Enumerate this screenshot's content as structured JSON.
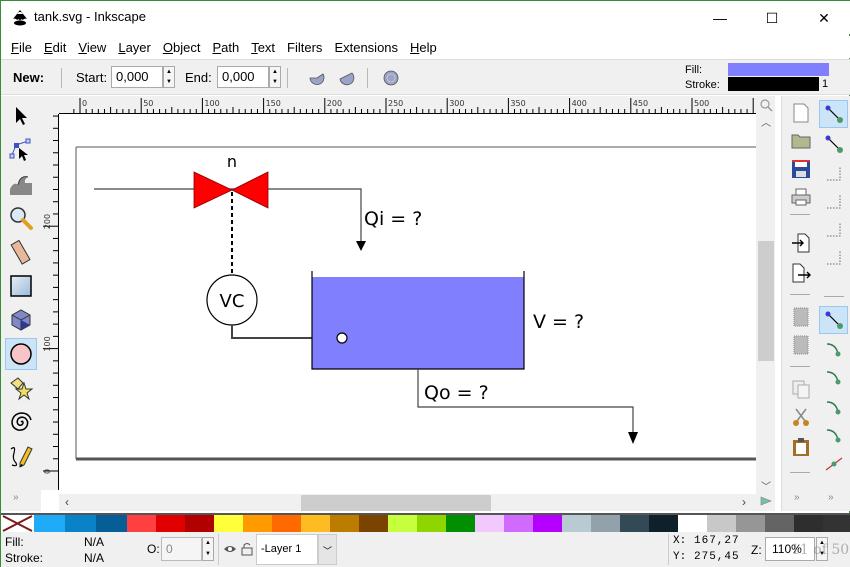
{
  "window": {
    "title": "tank.svg - Inkscape",
    "minimize_glyph": "—",
    "maximize_glyph": "☐",
    "close_glyph": "✕"
  },
  "menu": [
    {
      "label": "File",
      "accel": "F",
      "rest": "ile"
    },
    {
      "label": "Edit",
      "accel": "E",
      "rest": "dit"
    },
    {
      "label": "View",
      "accel": "V",
      "rest": "iew"
    },
    {
      "label": "Layer",
      "accel": "L",
      "rest": "ayer"
    },
    {
      "label": "Object",
      "accel": "O",
      "rest": "bject"
    },
    {
      "label": "Path",
      "accel": "P",
      "rest": "ath"
    },
    {
      "label": "Text",
      "accel": "T",
      "rest": "ext"
    },
    {
      "label": "Filters",
      "accel": "",
      "rest": "Filters"
    },
    {
      "label": "Extensions",
      "accel": "",
      "rest": "Extensions"
    },
    {
      "label": "Help",
      "accel": "H",
      "rest": "elp"
    }
  ],
  "tool_controls": {
    "new_label": "New:",
    "start_label": "Start:",
    "start_value": "0,000",
    "end_label": "End:",
    "end_value": "0,000",
    "buttons": [
      "arc-segment",
      "arc-slice",
      "whole-ellipse"
    ]
  },
  "style_indicator": {
    "fill_label": "Fill:",
    "stroke_label": "Stroke:",
    "fill_color": "#8080ff",
    "stroke_color": "#000000",
    "stroke_width": "1"
  },
  "toolbox": {
    "tools": [
      {
        "name": "selector",
        "icon": "arrow-icon"
      },
      {
        "name": "node",
        "icon": "node-edit-icon"
      },
      {
        "name": "tweak",
        "icon": "tweak-icon"
      },
      {
        "name": "zoom",
        "icon": "magnifier-icon"
      },
      {
        "name": "measure",
        "icon": "ruler-icon"
      },
      {
        "name": "rectangle",
        "icon": "rectangle-icon"
      },
      {
        "name": "3d-box",
        "icon": "box3d-icon"
      },
      {
        "name": "ellipse",
        "icon": "ellipse-icon",
        "active": true
      },
      {
        "name": "star",
        "icon": "star-icon"
      },
      {
        "name": "spiral",
        "icon": "spiral-icon"
      },
      {
        "name": "pencil",
        "icon": "pencil-icon"
      }
    ],
    "more": "»"
  },
  "rulers": {
    "horizontal_labels": [
      "0",
      "50",
      "100",
      "150",
      "200",
      "250",
      "300",
      "350",
      "400",
      "450",
      "500"
    ],
    "vertical_labels": [
      "200",
      "100",
      "0"
    ]
  },
  "drawing": {
    "valve_label": "n",
    "controller_label": "VC",
    "inflow_label": "Qi = ?",
    "volume_label": "V = ?",
    "outflow_label": "Qo = ?",
    "tank_fill": "#8080ff",
    "valve_color": "#ff0000"
  },
  "commands": [
    "new-document",
    "open",
    "save",
    "print",
    "import",
    "export",
    "undo",
    "redo",
    "copy",
    "cut",
    "paste"
  ],
  "snap_controls": [
    "snap-enable",
    "snap-bbox",
    "snap-bbox-edge",
    "snap-bbox-corner",
    "snap-bbox-midpoint",
    "snap-bbox-center",
    "snap-nodes",
    "snap-paths",
    "snap-path-intersection",
    "snap-cusp-nodes",
    "snap-smooth-nodes",
    "snap-others"
  ],
  "palette": [
    "#1fabf7",
    "#0a82c8",
    "#075d95",
    "#ff4040",
    "#e00000",
    "#b10000",
    "#ffff3a",
    "#ff9a00",
    "#ff6a00",
    "#ffbb22",
    "#bb7c00",
    "#7a4400",
    "#c6ff3d",
    "#8fd600",
    "#008f00",
    "#f1c9ff",
    "#d16bff",
    "#b500ff",
    "#b9cbd2",
    "#93a1aa",
    "#324a56",
    "#10202a",
    "#ffffff",
    "#c8c8c8",
    "#969696",
    "#646464",
    "#2e2e2e"
  ],
  "status": {
    "fill_label": "Fill:",
    "fill_value": "N/A",
    "stroke_label": "Stroke:",
    "stroke_value": "N/A",
    "opacity_label": "O:",
    "opacity_value": "0",
    "layer_name": "-Layer 1",
    "x_label": "X:",
    "x_value": "167,27",
    "y_label": "Y:",
    "y_value": "275,45",
    "zoom_label": "Z:",
    "zoom_value": "110%",
    "watermark": "11 of 50"
  }
}
